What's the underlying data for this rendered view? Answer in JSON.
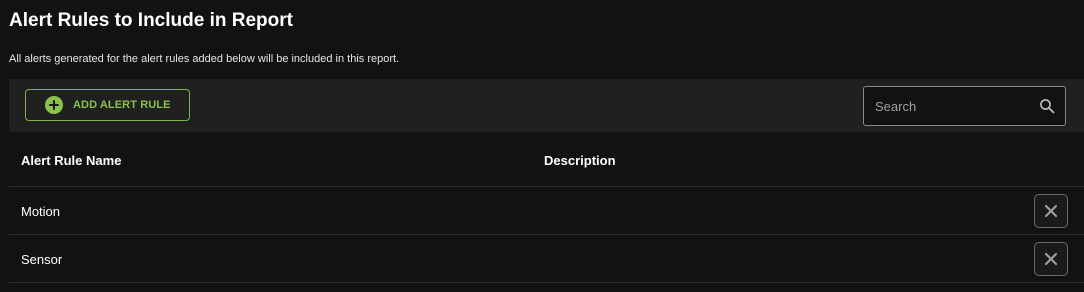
{
  "header": {
    "title": "Alert Rules to Include in Report",
    "subtitle": "All alerts generated for the alert rules added below will be included in this report."
  },
  "toolbar": {
    "add_label": "ADD ALERT RULE",
    "add_icon": "plus-circle-icon",
    "search_placeholder": "Search",
    "search_value": "",
    "search_icon": "search-icon"
  },
  "table": {
    "columns": [
      "Alert Rule Name",
      "Description"
    ],
    "rows": [
      {
        "name": "Motion",
        "description": ""
      },
      {
        "name": "Sensor",
        "description": ""
      }
    ],
    "remove_icon": "close-icon"
  },
  "colors": {
    "background": "#121212",
    "toolbar": "#202020",
    "accent": "#8bc34a",
    "text": "#ffffff"
  }
}
